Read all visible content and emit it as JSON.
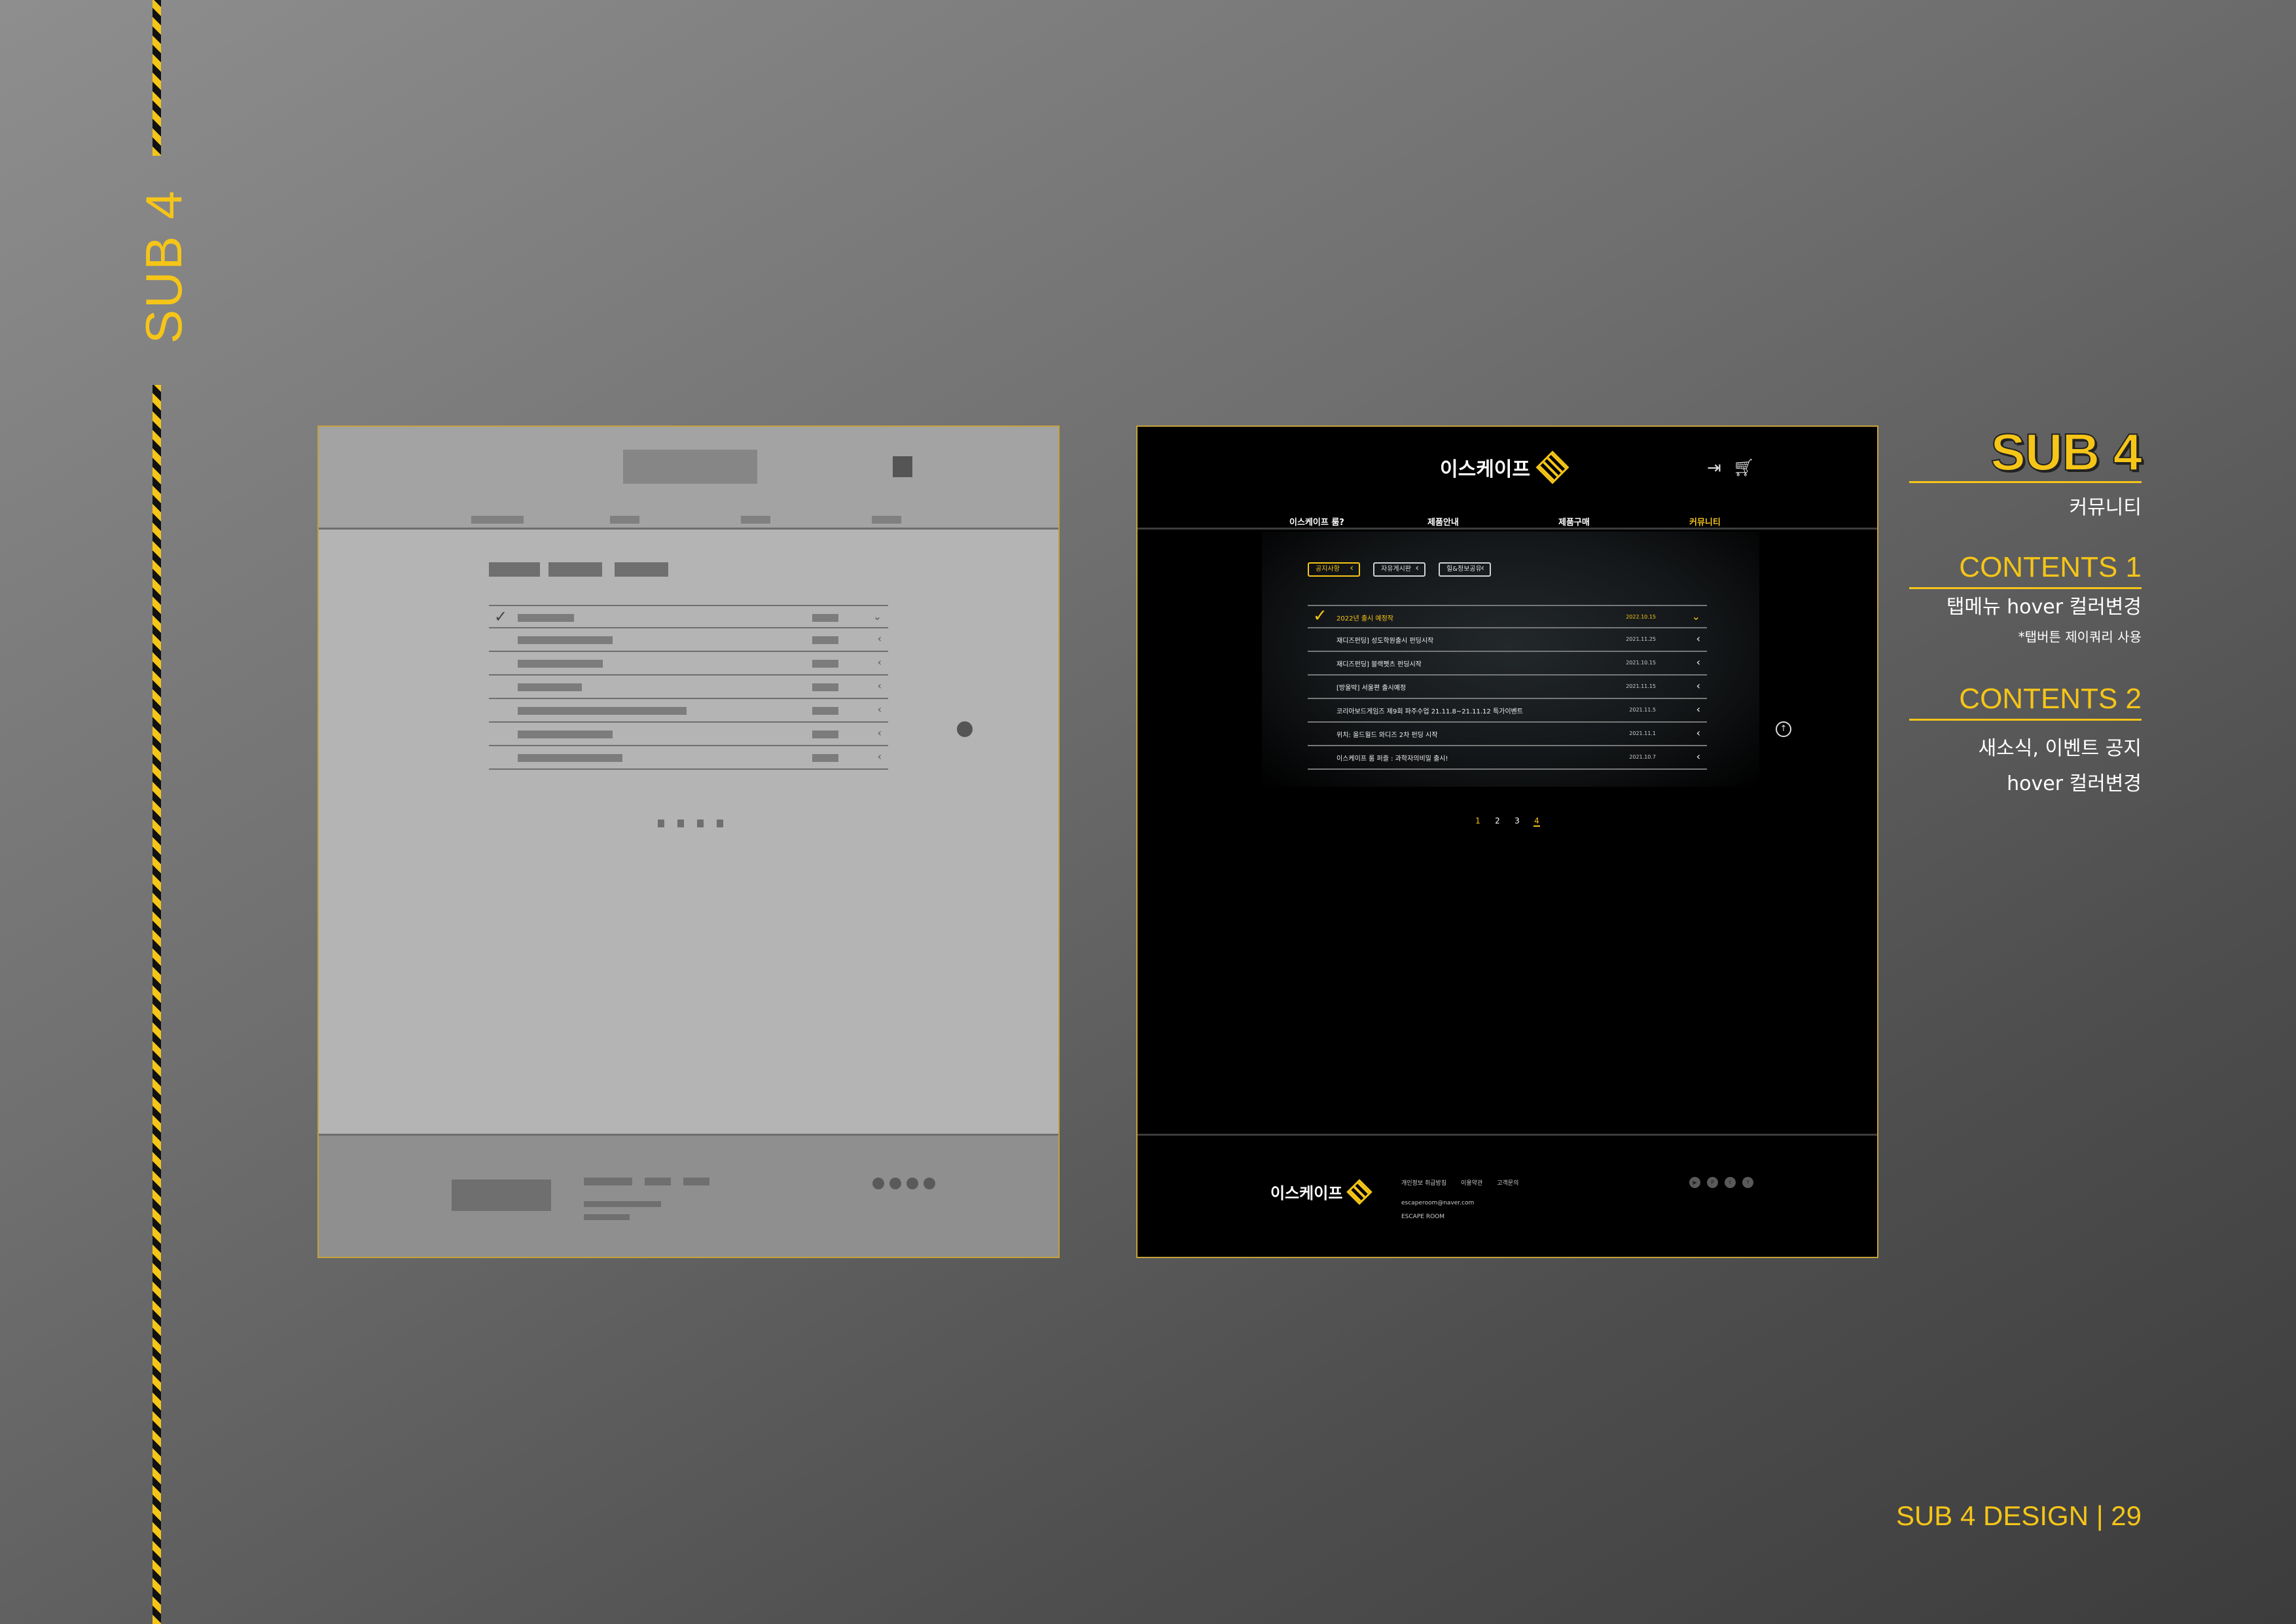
{
  "side_label": "SUB 4",
  "design": {
    "logo_text": "이스케이프",
    "icons": [
      "login-icon",
      "cart-icon"
    ],
    "nav": [
      {
        "label": "이스케이프 룸?",
        "active": false
      },
      {
        "label": "제품안내",
        "active": false
      },
      {
        "label": "제품구매",
        "active": false
      },
      {
        "label": "커뮤니티",
        "active": true
      }
    ],
    "tabs": [
      {
        "label": "공지사항",
        "active": true
      },
      {
        "label": "자유게시판",
        "active": false
      },
      {
        "label": "힐&정보공유",
        "active": false
      }
    ],
    "posts": [
      {
        "title": "2022년 출시 예정작",
        "date": "2022.10.15",
        "active": true
      },
      {
        "title": "재디즈펀딩] 성도학원출시 펀딩시작",
        "date": "2021.11.25",
        "active": false
      },
      {
        "title": "재디즈펀딩] 블랙펫츠 펀딩시작",
        "date": "2021.10.15",
        "active": false
      },
      {
        "title": "[방울박] 서울편 출시예정",
        "date": "2021.11.15",
        "active": false
      },
      {
        "title": "코리아보드게임즈 제9회 파주수업 21.11.8~21.11.12 특가이벤트",
        "date": "2021.11.5",
        "active": false
      },
      {
        "title": "위치: 올드월드 와디즈 2차 펀딩 시작",
        "date": "2021.11.1",
        "active": false
      },
      {
        "title": "이스케이프 룸 퍼즐 : 과학자의비밀 출시!",
        "date": "2021.10.7",
        "active": false
      }
    ],
    "pagination": [
      "1",
      "2",
      "3",
      "4"
    ],
    "current_page": "4",
    "footer": {
      "logo_text": "이스케이프",
      "links": [
        "개인정보 취급방침",
        "이용약관",
        "고객문의"
      ],
      "email": "escaperoom@naver.com",
      "name": "ESCAPE ROOM",
      "social_icons": [
        "youtube-icon",
        "pinterest-icon",
        "twitter-icon",
        "facebook-icon"
      ]
    }
  },
  "annotations": {
    "title": "SUB 4",
    "subtitle": "커뮤니티",
    "contents1_title": "CONTENTS 1",
    "contents1_body": "탭메뉴 hover 컬러변경",
    "contents1_note": "*탭버튼 제이쿼리 사용",
    "contents2_title": "CONTENTS 2",
    "contents2_line1": "새소식, 이벤트 공지",
    "contents2_line2": "hover 컬러변경"
  },
  "page_footer": "SUB 4 DESIGN  |  29",
  "colors": {
    "accent": "#f5c518",
    "background": "#5e5e5e",
    "wire": "#b4b4b4"
  }
}
